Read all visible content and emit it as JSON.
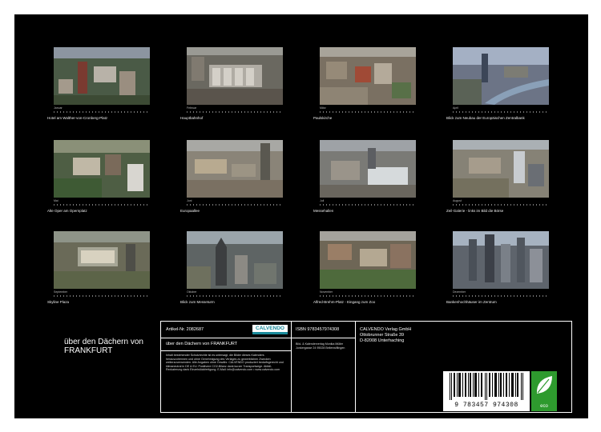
{
  "calendar": {
    "title_line1": "über den Dächern von",
    "title_line2": "FRANKFURT",
    "months": [
      {
        "month_label": "Januar",
        "caption": "Hotel am Walther-von-Cronberg-Platz"
      },
      {
        "month_label": "Februar",
        "caption": "Hauptbahnhof"
      },
      {
        "month_label": "März",
        "caption": "Paulskirche"
      },
      {
        "month_label": "April",
        "caption": "Blick zum Neubau der Europäischen Zentralbank"
      },
      {
        "month_label": "Mai",
        "caption": "Alte Oper am Opernplatz"
      },
      {
        "month_label": "Juni",
        "caption": "Europaallee"
      },
      {
        "month_label": "Juli",
        "caption": "Messehallen"
      },
      {
        "month_label": "August",
        "caption": "Zeil-Galerie - links im Bild die Börse"
      },
      {
        "month_label": "September",
        "caption": "Skyline Plaza"
      },
      {
        "month_label": "Oktober",
        "caption": "Blick zum Messeturm"
      },
      {
        "month_label": "November",
        "caption": "Alfred-Brehm-Platz - Eingang zum Zoo"
      },
      {
        "month_label": "Dezember",
        "caption": "Bankenhochhäuser im Zentrum"
      }
    ]
  },
  "info": {
    "artikel": "Artikel-Nr. 2082687",
    "publisher_logo": "CALVENDO",
    "subtitle": "über den Dächern von FRANKFURT",
    "legal_text": "Inhalt bestehender Schutzrechte ist es untersagt, die Bilder dieses Kalenders herauszutrennen und ohne Genehmigung des Verlages zu gewerblichen Zwecken weiterzuverwenden. Alle Angaben ohne Gewähr. CALVENDO produziert bedarfsgerecht und klimaneutral in DE & EU. Positivere CO2-Bilanz dank kurzer Transportwege. Abfall-Reduzierung dank Einzelstückfertigung. E-Mail: info@calvendo.com • www.calvendo.com",
    "isbn": "ISBN 9783457974308",
    "author_block": "Bild- & Kalenderverlag Monika Müller Junkergasse 24 95028 Beilenwiflingen",
    "verlag_line1": "CALVENDO Verlag GmbH",
    "verlag_line2": "Ottobrunner Straße 39",
    "verlag_line3": "D-82008 Unterhaching",
    "barcode_number": "9 783457 974308",
    "eco_label": "eco"
  }
}
